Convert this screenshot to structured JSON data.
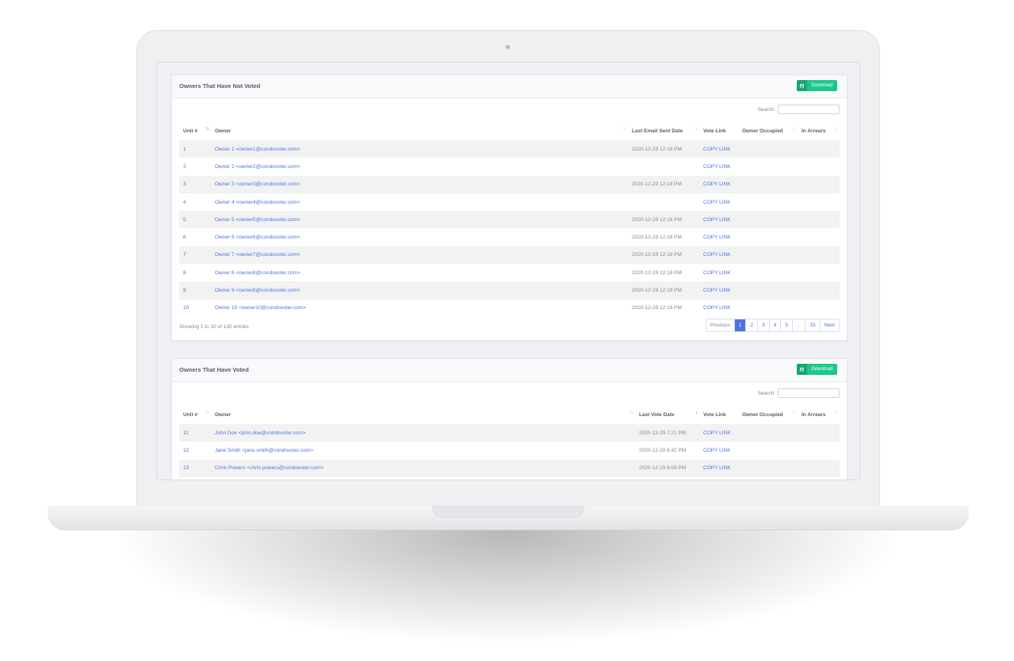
{
  "panel1": {
    "title": "Owners That Have Not Voted",
    "download_label": "Download",
    "search_label": "Search:",
    "columns": [
      "Unit #",
      "Owner",
      "Last Email Sent Date",
      "Vote Link",
      "Owner Occupied",
      "In Arrears"
    ],
    "rows": [
      {
        "unit": "1",
        "owner": "Owner 1 <owner1@condovoter.com>",
        "date": "2020-12-29 12:18 PM",
        "link": "COPY LINK"
      },
      {
        "unit": "2",
        "owner": "Owner 2 <owner2@condovoter.com>",
        "date": "",
        "link": "COPY LINK"
      },
      {
        "unit": "3",
        "owner": "Owner 3 <owner3@condovoter.com>",
        "date": "2020-12-29 12:18 PM",
        "link": "COPY LINK"
      },
      {
        "unit": "4",
        "owner": "Owner 4 <owner4@condovoter.com>",
        "date": "",
        "link": "COPY LINK"
      },
      {
        "unit": "5",
        "owner": "Owner 5 <owner5@condovoter.com>",
        "date": "2020-12-29 12:18 PM",
        "link": "COPY LINK"
      },
      {
        "unit": "6",
        "owner": "Owner 6 <owner6@condovoter.com>",
        "date": "2020-12-29 12:18 PM",
        "link": "COPY LINK"
      },
      {
        "unit": "7",
        "owner": "Owner 7 <owner7@condovoter.com>",
        "date": "2020-12-29 12:18 PM",
        "link": "COPY LINK"
      },
      {
        "unit": "8",
        "owner": "Owner 8 <owner8@condovoter.com>",
        "date": "2020-12-29 12:18 PM",
        "link": "COPY LINK"
      },
      {
        "unit": "9",
        "owner": "Owner 9 <owner9@condovoter.com>",
        "date": "2020-12-29 12:18 PM",
        "link": "COPY LINK"
      },
      {
        "unit": "10",
        "owner": "Owner 10 <owner10@condovoter.com>",
        "date": "2020-12-29 12:18 PM",
        "link": "COPY LINK"
      }
    ],
    "info": "Showing 1 to 10 of 130 entries",
    "pagination": [
      "Previous",
      "1",
      "2",
      "3",
      "4",
      "5",
      "...",
      "15",
      "Next"
    ],
    "active_page": "1"
  },
  "panel2": {
    "title": "Owners That Have Voted",
    "download_label": "Download",
    "search_label": "Search:",
    "columns": [
      "Unit #",
      "Owner",
      "Last Vote Date",
      "Vote Link",
      "Owner Occupied",
      "In Arrears"
    ],
    "rows": [
      {
        "unit": "11",
        "owner": "John Doe <john.doe@condovoter.com>",
        "date": "2020-12-29 7:21 PM",
        "link": "COPY LINK"
      },
      {
        "unit": "12",
        "owner": "Jane Smith <jane.smith@condovoter.com>",
        "date": "2020-12-29 6:42 PM",
        "link": "COPY LINK"
      },
      {
        "unit": "13",
        "owner": "Chris Powers <chris.powers@condovoter.com>",
        "date": "2020-12-29 6:08 PM",
        "link": "COPY LINK"
      }
    ]
  },
  "colors": {
    "accent": "#4e73df",
    "download": "#1cc88a",
    "stripe": "#f2f2f3"
  },
  "icons": {
    "download": "file-spreadsheet-icon",
    "sort": "sort-arrows-icon"
  }
}
